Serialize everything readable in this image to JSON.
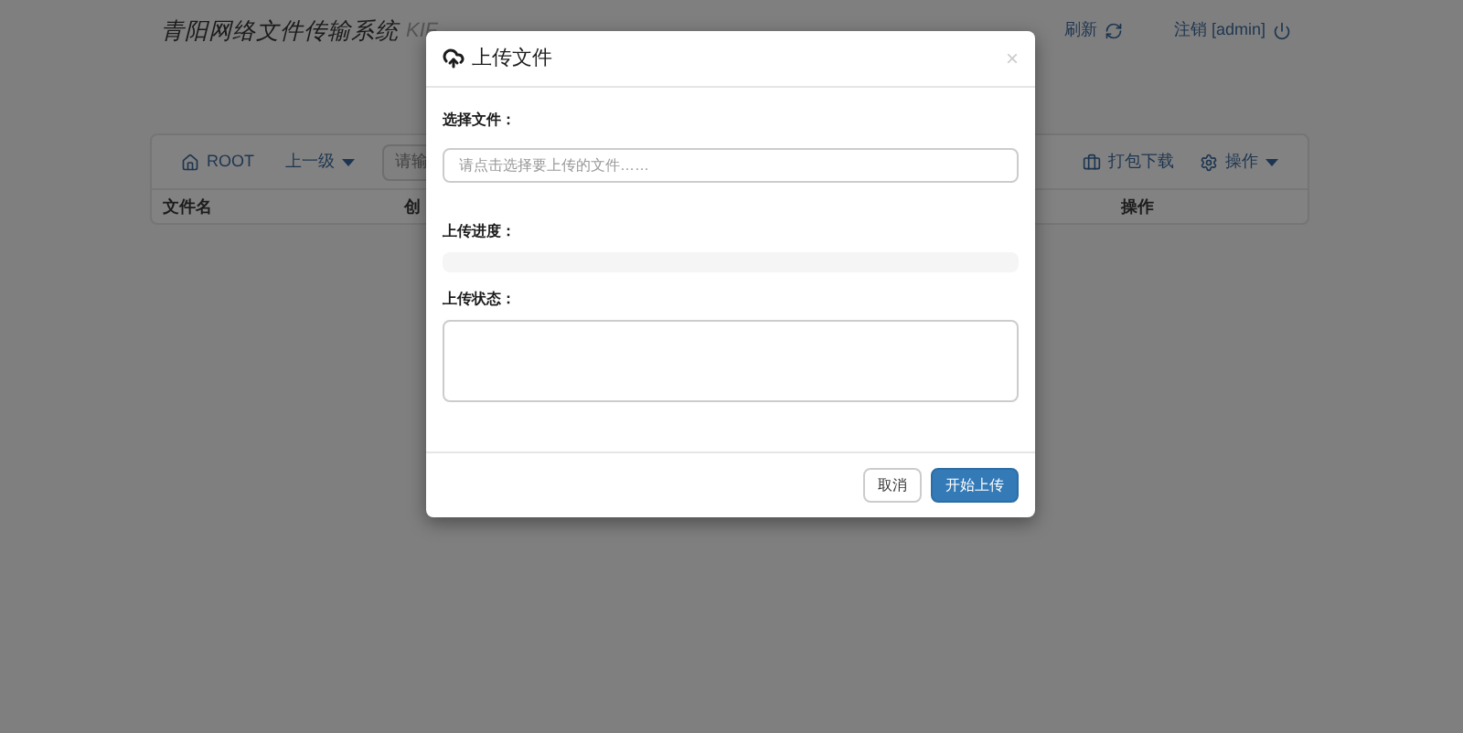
{
  "header": {
    "title": "青阳网络文件传输系统",
    "subtitle": "KIF",
    "actions": [
      {
        "label": "刷新"
      },
      {
        "label": "注销 [admin]"
      }
    ]
  },
  "toolbar": {
    "root": "ROOT",
    "up": "上一级",
    "search": {
      "placeholder": "请输"
    },
    "pack": "打包下载",
    "ops": "操作"
  },
  "table": {
    "columns": [
      "文件名",
      "创",
      "操作"
    ]
  },
  "dialog": {
    "title": "上传文件",
    "close": "×",
    "fields": [
      {
        "kind": "input",
        "label": "选择文件：",
        "placeholder": "请点击选择要上传的文件……"
      },
      {
        "kind": "progress",
        "label": "上传进度：",
        "level": 0
      },
      {
        "kind": "textarea",
        "label": "上传状态："
      }
    ],
    "buttons": [
      {
        "label": "取消",
        "primary": false
      },
      {
        "label": "开始上传",
        "primary": true
      }
    ]
  }
}
